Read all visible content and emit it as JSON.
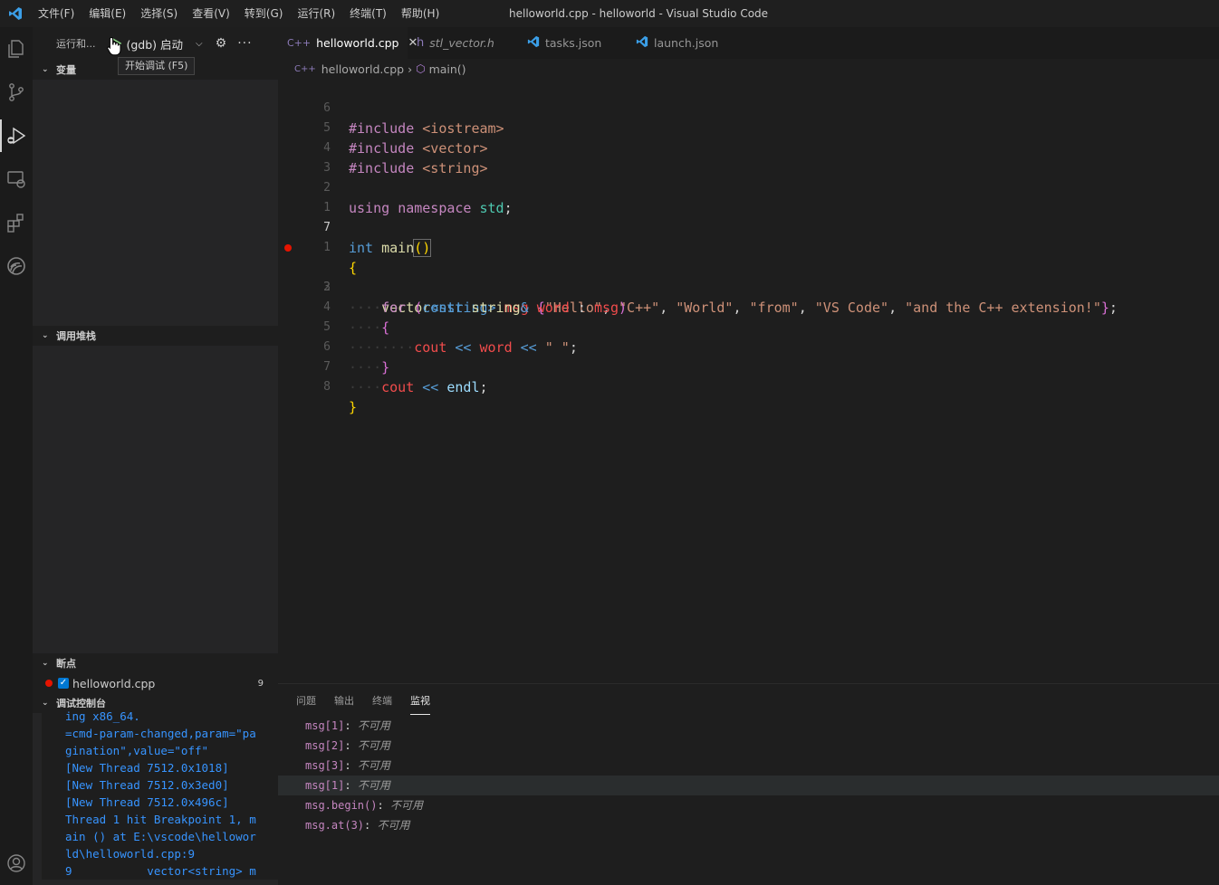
{
  "window_title": "helloworld.cpp - helloworld - Visual Studio Code",
  "menu": [
    "文件(F)",
    "编辑(E)",
    "选择(S)",
    "查看(V)",
    "转到(G)",
    "运行(R)",
    "终端(T)",
    "帮助(H)"
  ],
  "sidebar": {
    "title": "运行和...",
    "config": "(gdb) 启动",
    "tooltip": "开始调试 (F5)",
    "sections": {
      "variables": "变量",
      "callstack": "调用堆栈",
      "breakpoints": "断点",
      "console": "调试控制台"
    },
    "breakpoint": {
      "file": "helloworld.cpp",
      "line": "9"
    },
    "console_lines": [
      "ing x86_64.",
      "=cmd-param-changed,param=\"pa",
      "gination\",value=\"off\"",
      "[New Thread 7512.0x1018]",
      "[New Thread 7512.0x3ed0]",
      "[New Thread 7512.0x496c]",
      "",
      "Thread 1 hit Breakpoint 1, m",
      "ain () at E:\\vscode\\hellowor",
      "ld\\helloworld.cpp:9",
      "9           vector<string> m"
    ]
  },
  "tabs": [
    {
      "icon": "C++",
      "label": "helloworld.cpp",
      "active": true
    },
    {
      "icon": "h",
      "label": "stl_vector.h",
      "active": false
    },
    {
      "icon": "vscode-icon",
      "label": "tasks.json",
      "active": false
    },
    {
      "icon": "vscode-icon",
      "label": "launch.json",
      "active": false
    }
  ],
  "breadcrumb": {
    "file": "helloworld.cpp",
    "symbol": "main()"
  },
  "gutter": [
    "6",
    "5",
    "4",
    "3",
    "2",
    "1",
    "7",
    "1",
    "2",
    "3",
    "4",
    "5",
    "6",
    "7",
    "8"
  ],
  "code": {
    "l1": [
      "#include",
      "<iostream>"
    ],
    "l2": [
      "#include",
      "<vector>"
    ],
    "l3": [
      "#include",
      "<string>"
    ],
    "l5": [
      "using",
      "namespace",
      "std",
      ";"
    ],
    "l7": [
      "int",
      "main",
      "()"
    ],
    "l8": "{",
    "l9": [
      "vector",
      "<string>",
      "msg",
      "{",
      "\"Hello\"",
      ", ",
      "\"C++\"",
      ", ",
      "\"World\"",
      ", ",
      "\"from\"",
      ", ",
      "\"VS Code\"",
      ", ",
      "\"and the C++ extension!\"",
      "}",
      ";"
    ],
    "l10": [
      "for",
      "(",
      "const",
      "string",
      "&",
      "word",
      ":",
      "msg",
      ")"
    ],
    "l11": "{",
    "l12": [
      "cout",
      "<<",
      "word",
      "<<",
      "\" \"",
      ";"
    ],
    "l13": "}",
    "l14": [
      "cout",
      "<<",
      "endl",
      ";"
    ],
    "l15": "}"
  },
  "panel": {
    "tabs": [
      "问题",
      "输出",
      "终端",
      "监视"
    ],
    "watch": [
      {
        "name": "msg[1]",
        "value": "不可用"
      },
      {
        "name": "msg[2]",
        "value": "不可用"
      },
      {
        "name": "msg[3]",
        "value": "不可用"
      },
      {
        "name": "msg[1]",
        "value": "不可用"
      },
      {
        "name": "msg.begin()",
        "value": "不可用"
      },
      {
        "name": "msg.at(3)",
        "value": "不可用"
      }
    ]
  },
  "colors": {
    "accent": "#0078d4",
    "breakpoint": "#e51400",
    "run": "#89d185"
  }
}
